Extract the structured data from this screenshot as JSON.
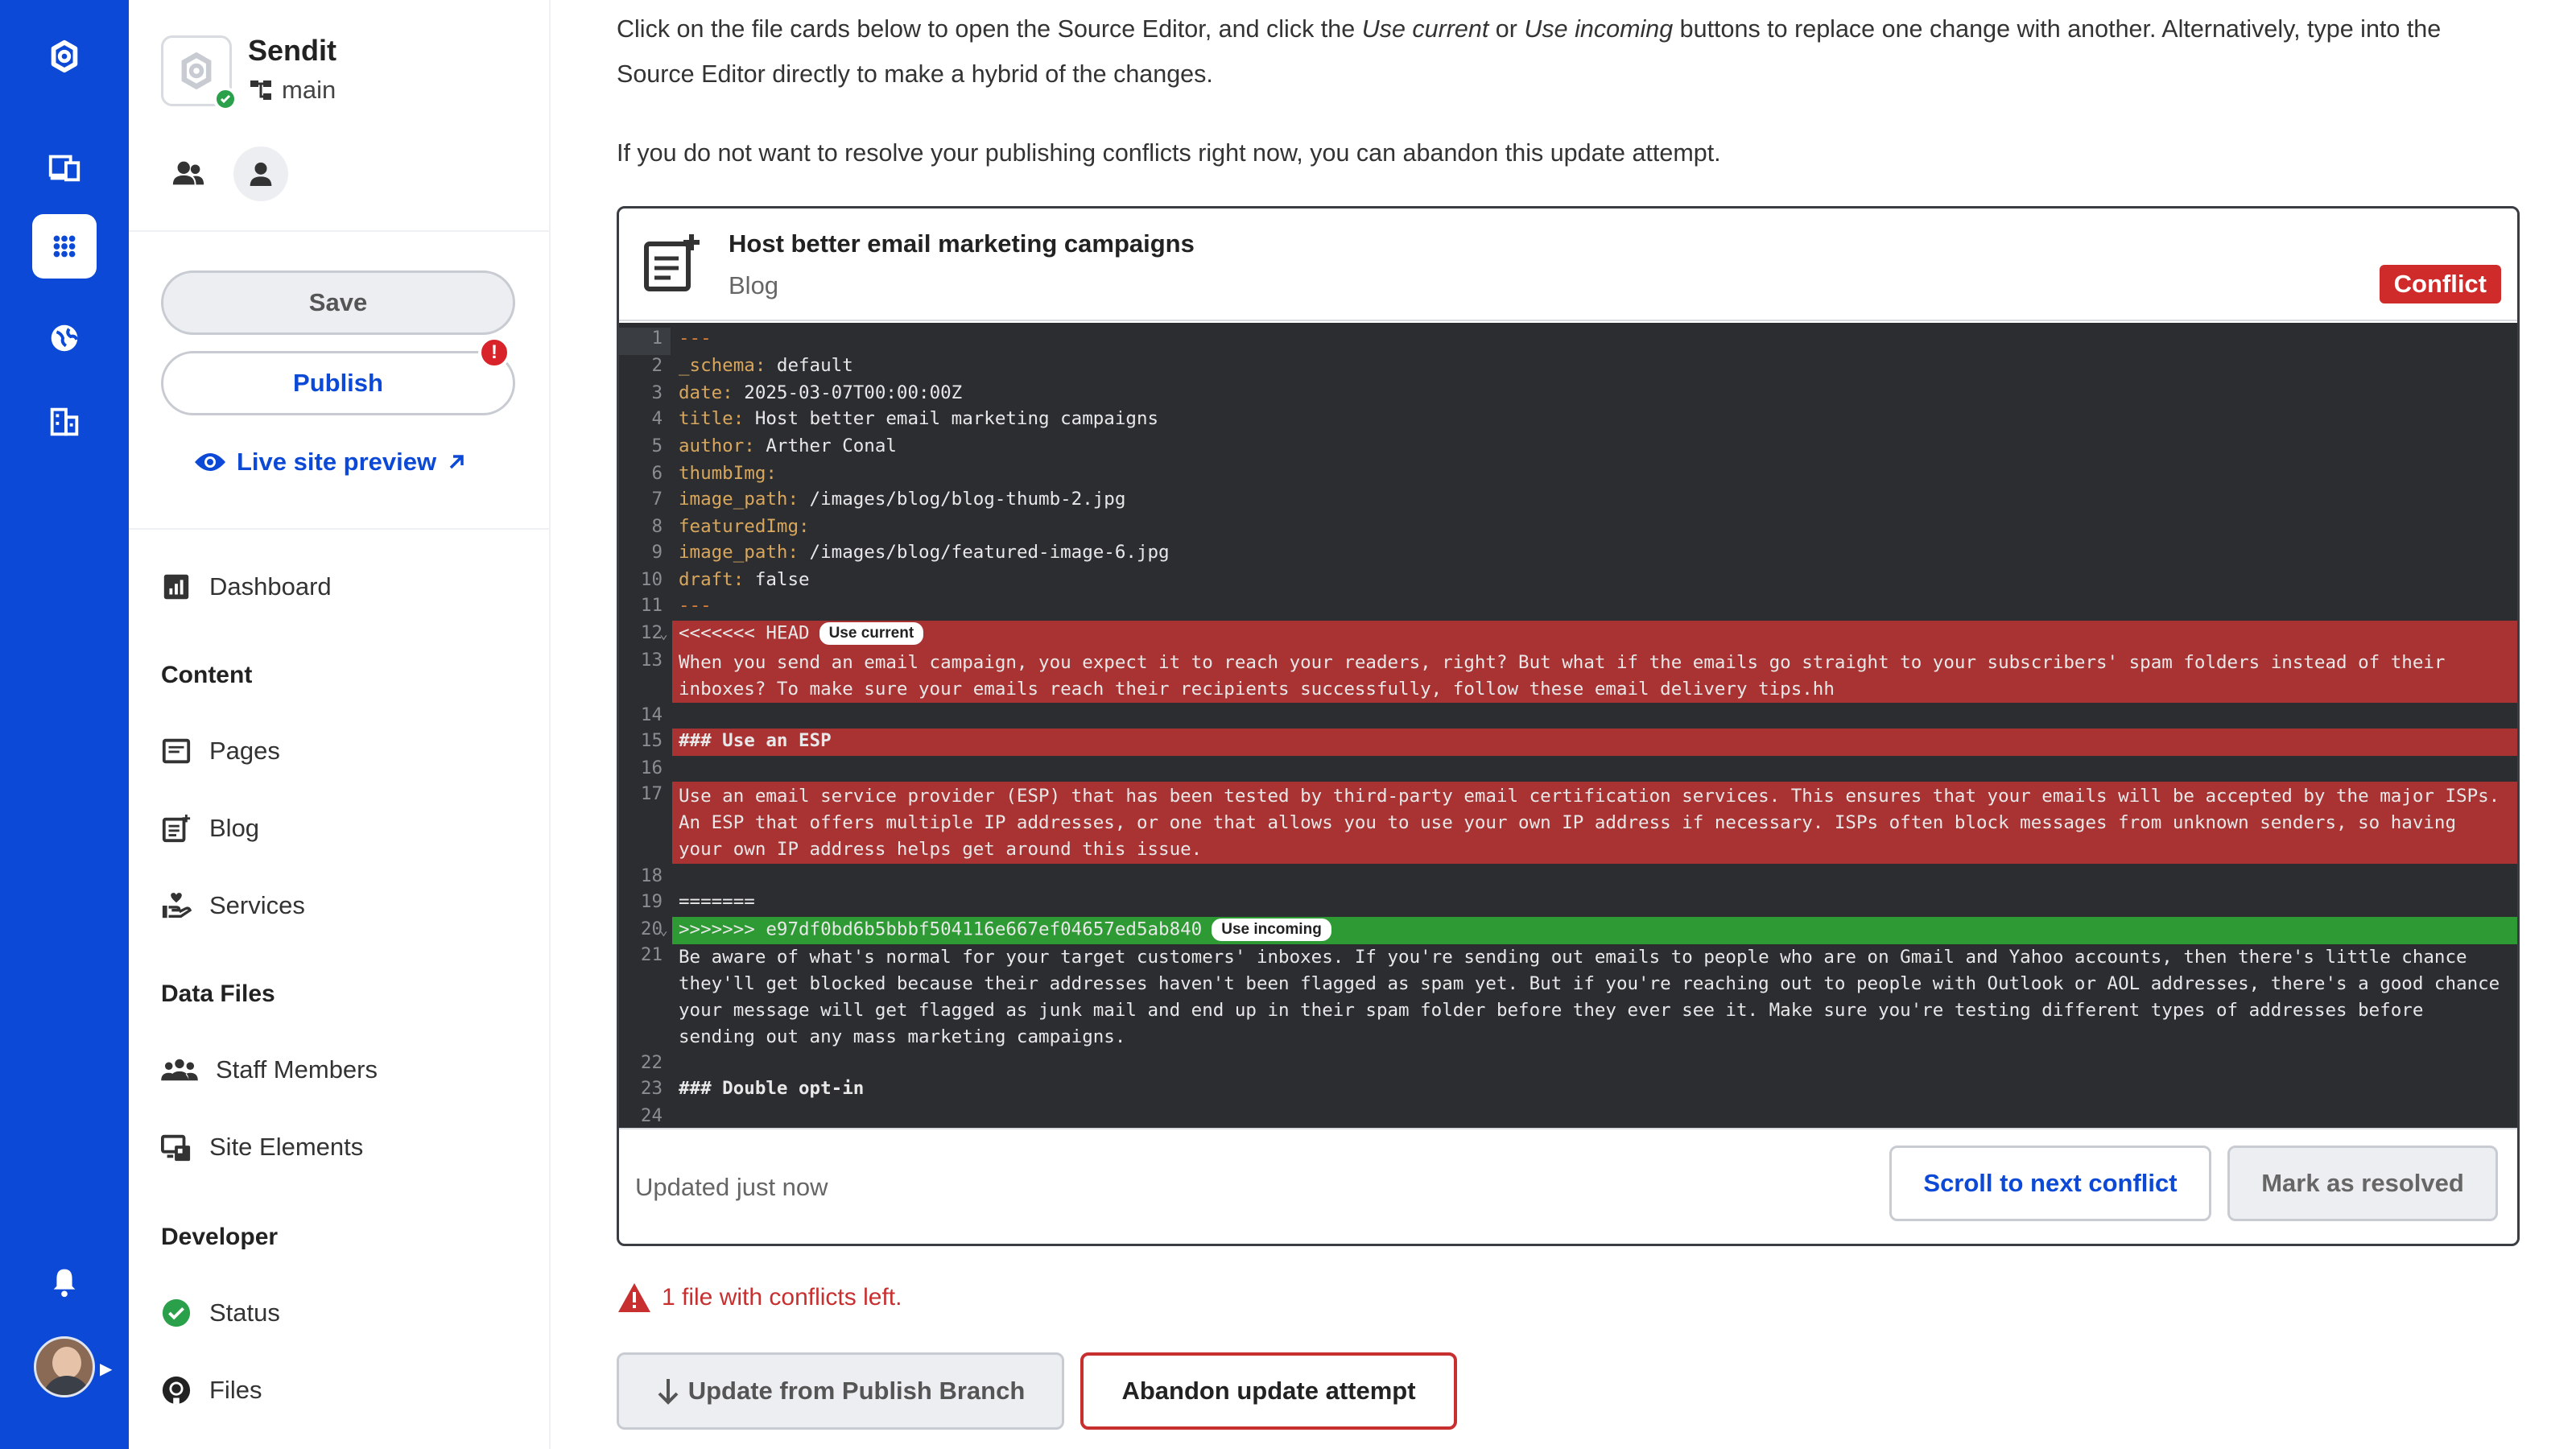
{
  "site": {
    "name": "Sendit",
    "branch": "main"
  },
  "sidebar": {
    "save_label": "Save",
    "publish_label": "Publish",
    "publish_alert": "!",
    "preview_label": "Live site preview",
    "dashboard": "Dashboard",
    "content_heading": "Content",
    "pages": "Pages",
    "blog": "Blog",
    "services": "Services",
    "data_heading": "Data Files",
    "staff": "Staff Members",
    "elements": "Site Elements",
    "developer_heading": "Developer",
    "status": "Status",
    "files": "Files"
  },
  "intro": {
    "p1_a": "Click on the file cards below to open the Source Editor, and click the ",
    "p1_b": "Use current",
    "p1_c": " or ",
    "p1_d": "Use incoming",
    "p1_e": " buttons to replace one change with another. Alternatively, type into the Source Editor directly to make a hybrid of the changes.",
    "p2": "If you do not want to resolve your publishing conflicts right now, you can abandon this update attempt."
  },
  "card": {
    "title": "Host better email marketing campaigns",
    "type": "Blog",
    "badge": "Conflict",
    "updated": "Updated just now",
    "next_label": "Scroll to next conflict",
    "resolve_label": "Mark as resolved"
  },
  "editor": {
    "n": [
      "1",
      "2",
      "3",
      "4",
      "5",
      "6",
      "7",
      "8",
      "9",
      "10",
      "11",
      "12",
      "13",
      "14",
      "15",
      "16",
      "17",
      "18",
      "19",
      "20",
      "21",
      "22",
      "23",
      "24"
    ],
    "l1": "---",
    "l2k": "_schema:",
    "l2v": " default",
    "l3k": "date:",
    "l3v": " 2025-03-07T00:00:00Z",
    "l4k": "title:",
    "l4v": " Host better email marketing campaigns",
    "l5k": "author:",
    "l5v": " Arther Conal",
    "l6k": "thumbImg:",
    "l7k": "image_path:",
    "l7v": " /images/blog/blog-thumb-2.jpg",
    "l8k": "featuredImg:",
    "l9k": "image_path:",
    "l9v": " /images/blog/featured-image-6.jpg",
    "l10k": "draft:",
    "l10v": " false",
    "l11": "---",
    "l12": "<<<<<<< HEAD",
    "use_current": "Use current",
    "l13": "When you send an email campaign, you expect it to reach your readers, right? But what if the emails go straight to your subscribers' spam folders instead of their inboxes? To make sure your emails reach their recipients successfully, follow these email delivery tips.hh",
    "l15": "### Use an ESP",
    "l17": "Use an email service provider (ESP) that has been tested by third-party email certification services. This ensures that your emails will be accepted by the major ISPs. An ESP that offers multiple IP addresses, or one that allows you to use your own IP address if necessary. ISPs often block messages from unknown senders, so having your own IP address helps get around this issue.",
    "l19": "=======",
    "l20": ">>>>>>> e97df0bd6b5bbbf504116e667ef04657ed5ab840",
    "use_incoming": "Use incoming",
    "l21": "Be aware of what's normal for your target customers' inboxes. If you're sending out emails to people who are on Gmail and Yahoo accounts, then there's little chance they'll get blocked because their addresses haven't been flagged as spam yet. But if you're reaching out to people with Outlook or AOL addresses, there's a good chance your message will get flagged as junk mail and end up in their spam folder before they ever see it. Make sure you're testing different types of addresses before sending out any mass marketing campaigns.",
    "l23": "### Double opt-in"
  },
  "footer": {
    "conflicts_left": "1 file with conflicts left.",
    "update_label": "Update from Publish Branch",
    "abandon_label": "Abandon update attempt"
  },
  "colors": {
    "brand": "#0b49d6",
    "conflict": "#cf2b2b",
    "current_bg": "#a93333",
    "incoming_bg": "#2e9a33"
  }
}
